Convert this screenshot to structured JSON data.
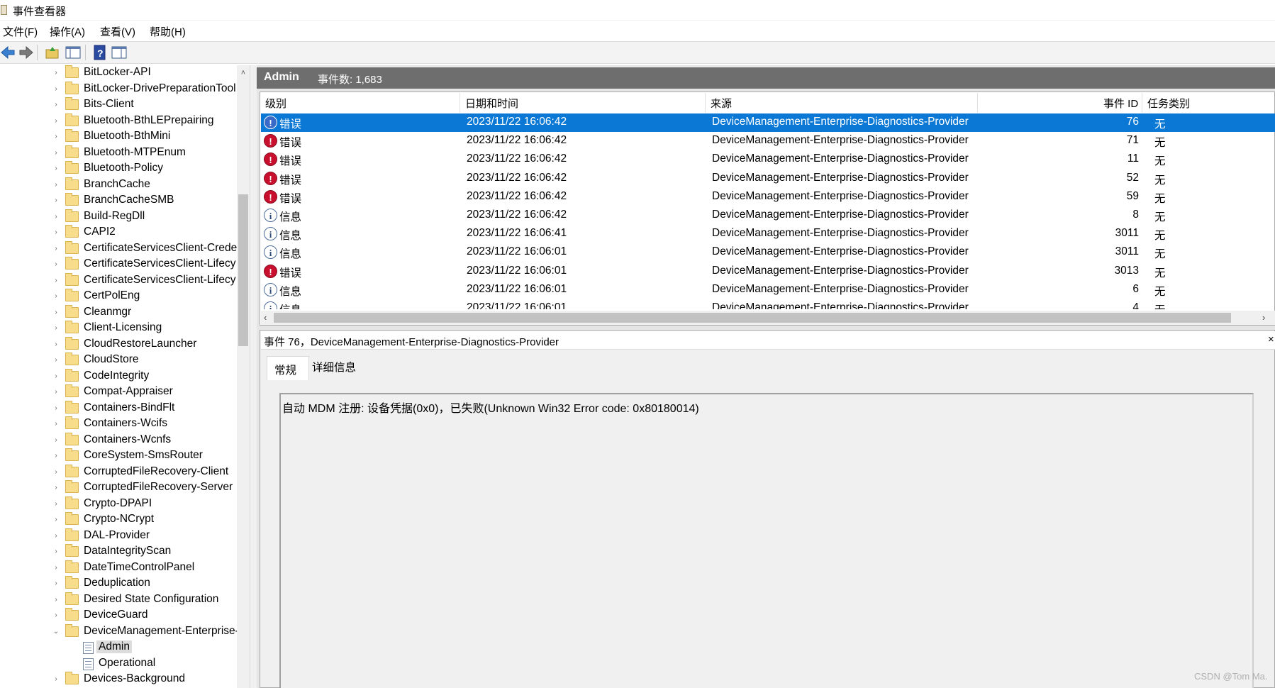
{
  "window": {
    "title": "事件查看器"
  },
  "menu": [
    {
      "label": "文件(F)"
    },
    {
      "label": "操作(A)"
    },
    {
      "label": "查看(V)"
    },
    {
      "label": "帮助(H)"
    }
  ],
  "toolbar": {
    "icons": [
      "back-arrow-icon",
      "forward-arrow-icon",
      "open-log-icon",
      "console-tree-icon",
      "help-icon",
      "action-pane-icon"
    ]
  },
  "tree": {
    "items": [
      {
        "label": "BitLocker-API",
        "arrow": "›",
        "type": "folder"
      },
      {
        "label": "BitLocker-DrivePreparationTool",
        "arrow": "›",
        "type": "folder"
      },
      {
        "label": "Bits-Client",
        "arrow": "›",
        "type": "folder"
      },
      {
        "label": "Bluetooth-BthLEPrepairing",
        "arrow": "›",
        "type": "folder"
      },
      {
        "label": "Bluetooth-BthMini",
        "arrow": "›",
        "type": "folder"
      },
      {
        "label": "Bluetooth-MTPEnum",
        "arrow": "›",
        "type": "folder"
      },
      {
        "label": "Bluetooth-Policy",
        "arrow": "›",
        "type": "folder"
      },
      {
        "label": "BranchCache",
        "arrow": "›",
        "type": "folder"
      },
      {
        "label": "BranchCacheSMB",
        "arrow": "›",
        "type": "folder"
      },
      {
        "label": "Build-RegDll",
        "arrow": "›",
        "type": "folder"
      },
      {
        "label": "CAPI2",
        "arrow": "›",
        "type": "folder"
      },
      {
        "label": "CertificateServicesClient-Crede",
        "arrow": "›",
        "type": "folder"
      },
      {
        "label": "CertificateServicesClient-Lifecy",
        "arrow": "›",
        "type": "folder"
      },
      {
        "label": "CertificateServicesClient-Lifecy",
        "arrow": "›",
        "type": "folder"
      },
      {
        "label": "CertPolEng",
        "arrow": "›",
        "type": "folder"
      },
      {
        "label": "Cleanmgr",
        "arrow": "›",
        "type": "folder"
      },
      {
        "label": "Client-Licensing",
        "arrow": "›",
        "type": "folder"
      },
      {
        "label": "CloudRestoreLauncher",
        "arrow": "›",
        "type": "folder"
      },
      {
        "label": "CloudStore",
        "arrow": "›",
        "type": "folder"
      },
      {
        "label": "CodeIntegrity",
        "arrow": "›",
        "type": "folder"
      },
      {
        "label": "Compat-Appraiser",
        "arrow": "›",
        "type": "folder"
      },
      {
        "label": "Containers-BindFlt",
        "arrow": "›",
        "type": "folder"
      },
      {
        "label": "Containers-Wcifs",
        "arrow": "›",
        "type": "folder"
      },
      {
        "label": "Containers-Wcnfs",
        "arrow": "›",
        "type": "folder"
      },
      {
        "label": "CoreSystem-SmsRouter",
        "arrow": "›",
        "type": "folder"
      },
      {
        "label": "CorruptedFileRecovery-Client",
        "arrow": "›",
        "type": "folder"
      },
      {
        "label": "CorruptedFileRecovery-Server",
        "arrow": "›",
        "type": "folder"
      },
      {
        "label": "Crypto-DPAPI",
        "arrow": "›",
        "type": "folder"
      },
      {
        "label": "Crypto-NCrypt",
        "arrow": "›",
        "type": "folder"
      },
      {
        "label": "DAL-Provider",
        "arrow": "›",
        "type": "folder"
      },
      {
        "label": "DataIntegrityScan",
        "arrow": "›",
        "type": "folder"
      },
      {
        "label": "DateTimeControlPanel",
        "arrow": "›",
        "type": "folder"
      },
      {
        "label": "Deduplication",
        "arrow": "›",
        "type": "folder"
      },
      {
        "label": "Desired State Configuration",
        "arrow": "›",
        "type": "folder"
      },
      {
        "label": "DeviceGuard",
        "arrow": "›",
        "type": "folder"
      },
      {
        "label": "DeviceManagement-Enterprise-",
        "arrow": "⌄",
        "type": "folder"
      },
      {
        "label": "Admin",
        "arrow": "",
        "type": "log",
        "selected": true
      },
      {
        "label": "Operational",
        "arrow": "",
        "type": "log"
      },
      {
        "label": "Devices-Background",
        "arrow": "›",
        "type": "folder"
      }
    ]
  },
  "header": {
    "title": "Admin",
    "count": "事件数: 1,683"
  },
  "grid": {
    "columns": {
      "level": "级别",
      "datetime": "日期和时间",
      "source": "来源",
      "event_id": "事件 ID",
      "task": "任务类别"
    },
    "rows": [
      {
        "level": "错误",
        "kind": "err",
        "datetime": "2023/11/22 16:06:42",
        "source": "DeviceManagement-Enterprise-Diagnostics-Provider",
        "event_id": "76",
        "task": "无",
        "selected": true
      },
      {
        "level": "错误",
        "kind": "err",
        "datetime": "2023/11/22 16:06:42",
        "source": "DeviceManagement-Enterprise-Diagnostics-Provider",
        "event_id": "71",
        "task": "无"
      },
      {
        "level": "错误",
        "kind": "err",
        "datetime": "2023/11/22 16:06:42",
        "source": "DeviceManagement-Enterprise-Diagnostics-Provider",
        "event_id": "11",
        "task": "无"
      },
      {
        "level": "错误",
        "kind": "err",
        "datetime": "2023/11/22 16:06:42",
        "source": "DeviceManagement-Enterprise-Diagnostics-Provider",
        "event_id": "52",
        "task": "无"
      },
      {
        "level": "错误",
        "kind": "err",
        "datetime": "2023/11/22 16:06:42",
        "source": "DeviceManagement-Enterprise-Diagnostics-Provider",
        "event_id": "59",
        "task": "无"
      },
      {
        "level": "信息",
        "kind": "info",
        "datetime": "2023/11/22 16:06:42",
        "source": "DeviceManagement-Enterprise-Diagnostics-Provider",
        "event_id": "8",
        "task": "无"
      },
      {
        "level": "信息",
        "kind": "info",
        "datetime": "2023/11/22 16:06:41",
        "source": "DeviceManagement-Enterprise-Diagnostics-Provider",
        "event_id": "3011",
        "task": "无"
      },
      {
        "level": "信息",
        "kind": "info",
        "datetime": "2023/11/22 16:06:01",
        "source": "DeviceManagement-Enterprise-Diagnostics-Provider",
        "event_id": "3011",
        "task": "无"
      },
      {
        "level": "错误",
        "kind": "err",
        "datetime": "2023/11/22 16:06:01",
        "source": "DeviceManagement-Enterprise-Diagnostics-Provider",
        "event_id": "3013",
        "task": "无"
      },
      {
        "level": "信息",
        "kind": "info",
        "datetime": "2023/11/22 16:06:01",
        "source": "DeviceManagement-Enterprise-Diagnostics-Provider",
        "event_id": "6",
        "task": "无"
      },
      {
        "level": "信息",
        "kind": "info",
        "datetime": "2023/11/22 16:06:01",
        "source": "DeviceManagement-Enterprise-Diagnostics-Provider",
        "event_id": "4",
        "task": "无"
      }
    ]
  },
  "detail": {
    "title": "事件 76，DeviceManagement-Enterprise-Diagnostics-Provider",
    "tabs": [
      "常规",
      "详细信息"
    ],
    "message": "自动 MDM 注册: 设备凭据(0x0)，已失败(Unknown Win32 Error code: 0x80180014)"
  },
  "watermark": "CSDN @Tom Ma.",
  "colors": {
    "selection": "#0a78d4",
    "header_bar": "#6e6e6e",
    "error": "#c8102e"
  }
}
